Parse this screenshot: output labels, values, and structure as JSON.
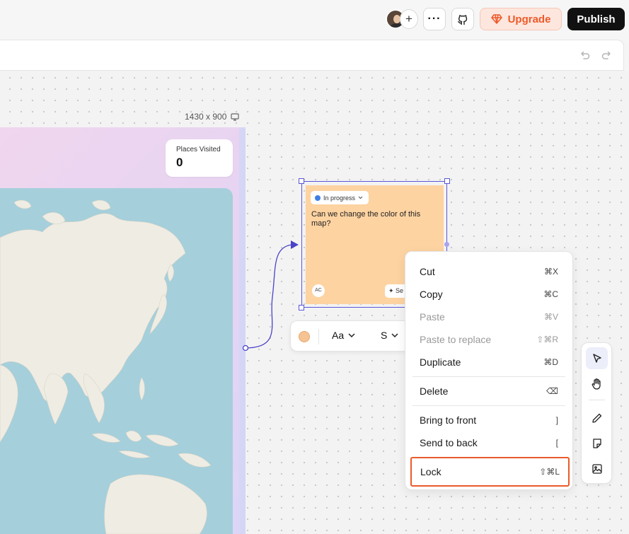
{
  "topbar": {
    "avatar_plus": "+",
    "more": "···",
    "upgrade_label": "Upgrade",
    "publish_label": "Publish"
  },
  "canvas": {
    "frame_size_label": "1430 x 900",
    "stat_card": {
      "label": "Places Visited",
      "value": "0"
    }
  },
  "sticky": {
    "status": "In progress",
    "text": "Can we change the color of this map?",
    "avatar_initials": "AC",
    "chip_label": "✦ Se"
  },
  "format_bar": {
    "font_label": "Aa",
    "size_label": "S"
  },
  "context_menu": {
    "items": [
      {
        "label": "Cut",
        "shortcut": "⌘X"
      },
      {
        "label": "Copy",
        "shortcut": "⌘C"
      },
      {
        "label": "Paste",
        "shortcut": "⌘V"
      },
      {
        "label": "Paste to replace",
        "shortcut": "⇧⌘R"
      },
      {
        "label": "Duplicate",
        "shortcut": "⌘D"
      },
      {
        "label": "Delete",
        "shortcut": "⌫"
      },
      {
        "label": "Bring to front",
        "shortcut": "]"
      },
      {
        "label": "Send to back",
        "shortcut": "["
      },
      {
        "label": "Lock",
        "shortcut": "⇧⌘L"
      }
    ]
  },
  "colors": {
    "accent": "#5b55d8",
    "upgrade": "#ee5a2a",
    "sticky": "#fdd3a1",
    "highlight": "#ea5a2a"
  }
}
